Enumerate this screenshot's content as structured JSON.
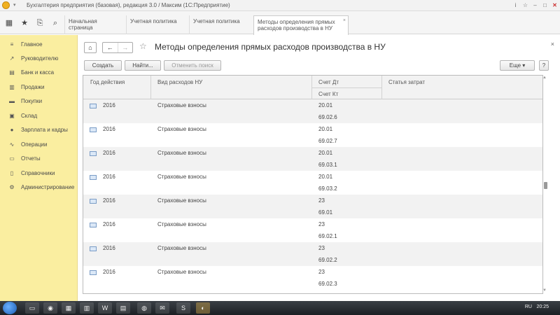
{
  "window": {
    "title": "Бухгалтерия предприятия (базовая), редакция 3.0 / Максим  (1С:Предприятие)",
    "controls": [
      "i",
      "☆",
      "–",
      "□",
      "✕"
    ]
  },
  "toolbar": {
    "tools": [
      "grid-icon",
      "star-icon",
      "history-icon",
      "search-icon"
    ]
  },
  "tabs": [
    {
      "label": "Начальная страница"
    },
    {
      "label": "Учетная политика"
    },
    {
      "label": "Учетная политика"
    },
    {
      "label": "Методы определения прямых расходов производства в НУ"
    }
  ],
  "sidebar": {
    "items": [
      {
        "label": "Главное",
        "icon": "menu-icon"
      },
      {
        "label": "Руководителю",
        "icon": "chart-icon"
      },
      {
        "label": "Банк и касса",
        "icon": "bank-icon"
      },
      {
        "label": "Продажи",
        "icon": "cart-icon"
      },
      {
        "label": "Покупки",
        "icon": "truck-icon"
      },
      {
        "label": "Склад",
        "icon": "warehouse-icon"
      },
      {
        "label": "Зарплата и кадры",
        "icon": "person-icon"
      },
      {
        "label": "Операции",
        "icon": "operations-icon"
      },
      {
        "label": "Отчеты",
        "icon": "reports-icon"
      },
      {
        "label": "Справочники",
        "icon": "book-icon"
      },
      {
        "label": "Администрирование",
        "icon": "gear-icon"
      }
    ]
  },
  "page": {
    "title": "Методы определения прямых расходов производства в НУ",
    "buttons": {
      "create": "Создать",
      "find": "Найти...",
      "cancel_search": "Отменить поиск",
      "more": "Еще",
      "help": "?"
    }
  },
  "table": {
    "headers": {
      "year": "Год действия",
      "expense_type": "Вид расходов НУ",
      "debit": "Счет Дт",
      "credit": "Счет Кт",
      "cost_item": "Статья затрат"
    },
    "rows": [
      {
        "year": "2016",
        "expense_type": "Страховые взносы",
        "debit": "20.01",
        "credit": "69.02.6"
      },
      {
        "year": "2016",
        "expense_type": "Страховые взносы",
        "debit": "20.01",
        "credit": "69.02.7"
      },
      {
        "year": "2016",
        "expense_type": "Страховые взносы",
        "debit": "20.01",
        "credit": "69.03.1"
      },
      {
        "year": "2016",
        "expense_type": "Страховые взносы",
        "debit": "20.01",
        "credit": "69.03.2"
      },
      {
        "year": "2016",
        "expense_type": "Страховые взносы",
        "debit": "23",
        "credit": "69.01"
      },
      {
        "year": "2016",
        "expense_type": "Страховые взносы",
        "debit": "23",
        "credit": "69.02.1"
      },
      {
        "year": "2016",
        "expense_type": "Страховые взносы",
        "debit": "23",
        "credit": "69.02.2"
      },
      {
        "year": "2016",
        "expense_type": "Страховые взносы",
        "debit": "23",
        "credit": "69.02.3"
      }
    ]
  },
  "taskbar": {
    "language": "RU",
    "time": "20:25"
  }
}
